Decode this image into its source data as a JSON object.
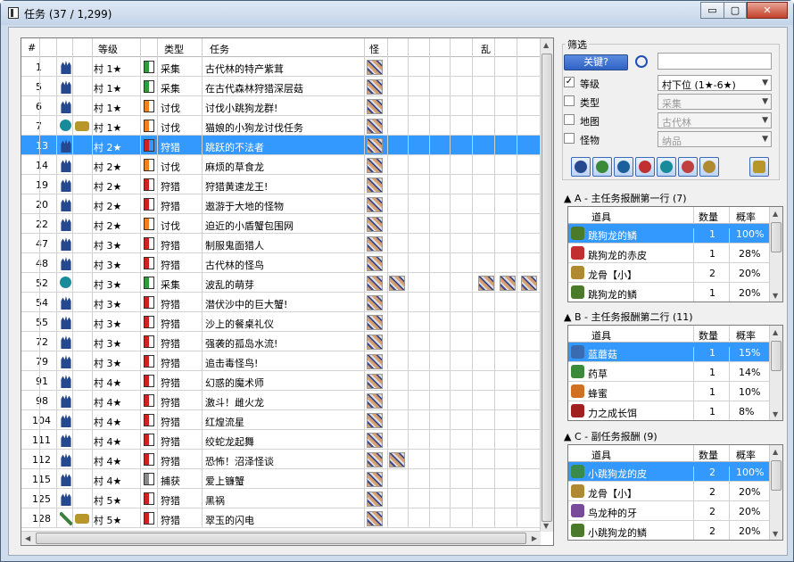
{
  "window": {
    "title": "任务 (37 / 1,299)",
    "min": "▭",
    "max": "▢",
    "close": "✕"
  },
  "table": {
    "headers": {
      "num": "#",
      "rank": "等级",
      "type": "类型",
      "quest": "任务",
      "monster": "怪",
      "frenzy": "乱"
    },
    "rows": [
      {
        "num": "1",
        "icons": [
          "loc"
        ],
        "rank": "村 1★",
        "book": "g",
        "type": "采集",
        "quest": "古代林的特产紫茸",
        "mons": 1,
        "sel": false
      },
      {
        "num": "5",
        "icons": [
          "loc"
        ],
        "rank": "村 1★",
        "book": "g",
        "type": "采集",
        "quest": "在古代森林狩猎深层菇",
        "mons": 1,
        "sel": false
      },
      {
        "num": "6",
        "icons": [
          "loc"
        ],
        "rank": "村 1★",
        "book": "o",
        "type": "讨伐",
        "quest": "讨伐小跳狗龙群!",
        "mons": 1,
        "sel": false
      },
      {
        "num": "7",
        "icons": [
          "gear",
          "chat"
        ],
        "rank": "村 1★",
        "book": "o",
        "type": "讨伐",
        "quest": "猫娘的小狗龙讨伐任务",
        "mons": 1,
        "sel": false
      },
      {
        "num": "13",
        "icons": [
          "loc"
        ],
        "rank": "村 2★",
        "book": "r",
        "type": "狩猎",
        "quest": "跳跃的不法者",
        "mons": 1,
        "sel": true
      },
      {
        "num": "14",
        "icons": [
          "loc"
        ],
        "rank": "村 2★",
        "book": "o",
        "type": "讨伐",
        "quest": "麻烦的草食龙",
        "mons": 1,
        "sel": false
      },
      {
        "num": "19",
        "icons": [
          "loc"
        ],
        "rank": "村 2★",
        "book": "r",
        "type": "狩猎",
        "quest": "狩猎黄速龙王!",
        "mons": 1,
        "sel": false
      },
      {
        "num": "20",
        "icons": [
          "loc"
        ],
        "rank": "村 2★",
        "book": "r",
        "type": "狩猎",
        "quest": "遨游于大地的怪物",
        "mons": 1,
        "sel": false
      },
      {
        "num": "22",
        "icons": [
          "loc"
        ],
        "rank": "村 2★",
        "book": "o",
        "type": "讨伐",
        "quest": "迫近的小盾蟹包围网",
        "mons": 1,
        "sel": false
      },
      {
        "num": "47",
        "icons": [
          "loc"
        ],
        "rank": "村 3★",
        "book": "r",
        "type": "狩猎",
        "quest": "制服鬼面猎人",
        "mons": 1,
        "sel": false
      },
      {
        "num": "48",
        "icons": [
          "loc"
        ],
        "rank": "村 3★",
        "book": "r",
        "type": "狩猎",
        "quest": "古代林的怪鸟",
        "mons": 1,
        "sel": false
      },
      {
        "num": "52",
        "icons": [
          "gear"
        ],
        "rank": "村 3★",
        "book": "g",
        "type": "采集",
        "quest": "波乱的萌芽",
        "mons": 2,
        "sel": false
      },
      {
        "num": "54",
        "icons": [
          "loc"
        ],
        "rank": "村 3★",
        "book": "r",
        "type": "狩猎",
        "quest": "潜伏沙中的巨大蟹!",
        "mons": 1,
        "sel": false
      },
      {
        "num": "55",
        "icons": [
          "loc"
        ],
        "rank": "村 3★",
        "book": "r",
        "type": "狩猎",
        "quest": "沙上的餐桌礼仪",
        "mons": 1,
        "sel": false
      },
      {
        "num": "72",
        "icons": [
          "loc"
        ],
        "rank": "村 3★",
        "book": "r",
        "type": "狩猎",
        "quest": "强袭的孤岛水流!",
        "mons": 1,
        "sel": false
      },
      {
        "num": "79",
        "icons": [
          "loc"
        ],
        "rank": "村 3★",
        "book": "r",
        "type": "狩猎",
        "quest": "追击毒怪鸟!",
        "mons": 1,
        "sel": false
      },
      {
        "num": "91",
        "icons": [
          "loc"
        ],
        "rank": "村 4★",
        "book": "r",
        "type": "狩猎",
        "quest": "幻惑的魔术师",
        "mons": 1,
        "sel": false
      },
      {
        "num": "98",
        "icons": [
          "loc"
        ],
        "rank": "村 4★",
        "book": "r",
        "type": "狩猎",
        "quest": "激斗！雌火龙",
        "mons": 1,
        "sel": false
      },
      {
        "num": "104",
        "icons": [
          "loc"
        ],
        "rank": "村 4★",
        "book": "r",
        "type": "狩猎",
        "quest": "红煌流星",
        "mons": 1,
        "sel": false
      },
      {
        "num": "111",
        "icons": [
          "loc"
        ],
        "rank": "村 4★",
        "book": "r",
        "type": "狩猎",
        "quest": "绞蛇龙起舞",
        "mons": 1,
        "sel": false
      },
      {
        "num": "112",
        "icons": [
          "loc"
        ],
        "rank": "村 4★",
        "book": "r",
        "type": "狩猎",
        "quest": "恐怖！沼泽怪谈",
        "mons": 2,
        "sel": false
      },
      {
        "num": "115",
        "icons": [
          "loc"
        ],
        "rank": "村 4★",
        "book": "s",
        "type": "捕获",
        "quest": "爱上镰蟹",
        "mons": 1,
        "sel": false
      },
      {
        "num": "125",
        "icons": [
          "loc"
        ],
        "rank": "村 5★",
        "book": "r",
        "type": "狩猎",
        "quest": "黑祸",
        "mons": 1,
        "sel": false
      },
      {
        "num": "128",
        "icons": [
          "sword",
          "chat"
        ],
        "rank": "村 5★",
        "book": "r",
        "type": "狩猎",
        "quest": "翠玉的闪电",
        "mons": 1,
        "sel": false
      }
    ]
  },
  "filter": {
    "title": "筛选",
    "keyword_button": "关键?",
    "keyword_value": "",
    "rows": [
      {
        "label": "等级",
        "checked": true,
        "value": "村下位 (1★-6★)"
      },
      {
        "label": "类型",
        "checked": false,
        "value": "采集"
      },
      {
        "label": "地图",
        "checked": false,
        "value": "古代林"
      },
      {
        "label": "怪物",
        "checked": false,
        "value": "纳品"
      }
    ]
  },
  "rewards": [
    {
      "title": "A - 主任务报酬第一行 (7)",
      "headers": [
        "道具",
        "数量",
        "概率"
      ],
      "items": [
        {
          "name": "跳狗龙的鳞",
          "qty": "1",
          "pct": "100%",
          "color": "#4a7a2a",
          "sel": true
        },
        {
          "name": "跳狗龙的赤皮",
          "qty": "1",
          "pct": "28%",
          "color": "#c03030",
          "sel": false
        },
        {
          "name": "龙骨【小】",
          "qty": "2",
          "pct": "20%",
          "color": "#b08a30",
          "sel": false
        },
        {
          "name": "跳狗龙的鳞",
          "qty": "1",
          "pct": "20%",
          "color": "#4a7a2a",
          "sel": false
        }
      ]
    },
    {
      "title": "B - 主任务报酬第二行 (11)",
      "headers": [
        "道具",
        "数量",
        "概率"
      ],
      "items": [
        {
          "name": "蓝蘑菇",
          "qty": "1",
          "pct": "15%",
          "color": "#3a6ab0",
          "sel": true
        },
        {
          "name": "药草",
          "qty": "1",
          "pct": "14%",
          "color": "#3a8a3a",
          "sel": false
        },
        {
          "name": "蜂蜜",
          "qty": "1",
          "pct": "10%",
          "color": "#d07020",
          "sel": false
        },
        {
          "name": "力之成长饵",
          "qty": "1",
          "pct": "8%",
          "color": "#a02020",
          "sel": false
        }
      ]
    },
    {
      "title": "C - 副任务报酬 (9)",
      "headers": [
        "道具",
        "数量",
        "概率"
      ],
      "items": [
        {
          "name": "小跳狗龙的皮",
          "qty": "2",
          "pct": "100%",
          "color": "#3a8a4a",
          "sel": true
        },
        {
          "name": "龙骨【小】",
          "qty": "2",
          "pct": "20%",
          "color": "#b08a30",
          "sel": false
        },
        {
          "name": "鸟龙种的牙",
          "qty": "2",
          "pct": "20%",
          "color": "#7a4a9a",
          "sel": false
        },
        {
          "name": "小跳狗龙的鳞",
          "qty": "2",
          "pct": "20%",
          "color": "#4a7a2a",
          "sel": false
        }
      ]
    }
  ]
}
